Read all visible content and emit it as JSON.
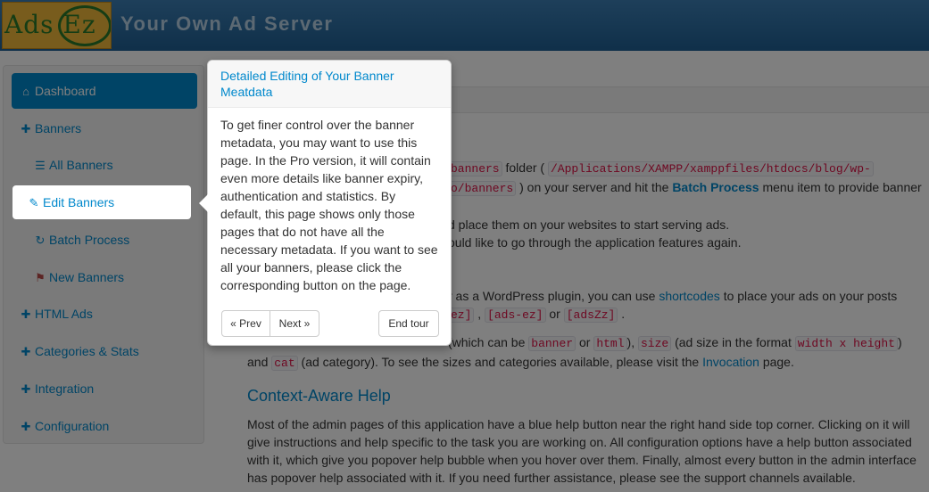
{
  "header": {
    "logo_text": "Ads Ez",
    "title": "Your Own Ad Server"
  },
  "sidebar": {
    "items": [
      {
        "label": "Dashboard",
        "icon": "home-icon"
      },
      {
        "label": "Banners",
        "icon": "plus-icon"
      },
      {
        "label": "All Banners",
        "icon": "list-icon"
      },
      {
        "label": "Edit Banners",
        "icon": "pencil-icon"
      },
      {
        "label": "Batch Process",
        "icon": "refresh-icon"
      },
      {
        "label": "New Banners",
        "icon": "flag-icon"
      },
      {
        "label": "HTML Ads",
        "icon": "plus-icon"
      },
      {
        "label": "Categories & Stats",
        "icon": "plus-icon"
      },
      {
        "label": "Integration",
        "icon": "plus-icon"
      },
      {
        "label": "Configuration",
        "icon": "plus-icon"
      }
    ]
  },
  "content": {
    "p1_frag1": "banners",
    "p1_frag2": "folder (",
    "p1_path1": "/Applications/XAMPP/xamppfiles/htdocs/blog/wp-",
    "p1_path2": "o/banners",
    "p1_frag3": ") on your server and hit the",
    "p1_link": "Batch Process",
    "p1_frag4": "menu item to provide banner",
    "p2": "d place them on your websites to start serving ads.",
    "p3": "ould like to go through the application features again.",
    "p4_frag1": "r as a WordPress plugin, you can use",
    "p4_link": "shortcodes",
    "p4_frag2": "to place your ads on your posts",
    "p4_code1": "ez]",
    "p4_code2": "[ads-ez]",
    "p4_or": "or",
    "p4_code3": "[adsZz]",
    "p5_frag1": "(which can be",
    "p5_code1": "banner",
    "p5_or": "or",
    "p5_code2": "html",
    "p5_frag2": "),",
    "p5_code3": "size",
    "p5_frag3": "(ad size in the format",
    "p5_code4": "width x height",
    "p5_frag4": ")",
    "p6_and": "and",
    "p6_code": "cat",
    "p6_frag1": "(ad category). To see the sizes and categories available, please visit the",
    "p6_link": "Invocation",
    "p6_frag2": "page.",
    "help_heading": "Context-Aware Help",
    "help_text": "Most of the admin pages of this application have a blue help button near the right hand side top corner. Clicking on it will give instructions and help specific to the task you are working on. All configuration options have a help button associated with it, which give you popover help bubble when you hover over them. Finally, almost every button in the admin interface has popover help associated with it. If you need further assistance, please see the support channels available."
  },
  "tour": {
    "title": "Detailed Editing of Your Banner Meatdata",
    "body": "To get finer control over the banner metadata, you may want to use this page. In the Pro version, it will contain even more details like banner expiry, authentication and statistics. By default, this page shows only those pages that do not have all the necessary metadata. If you want to see all your banners, please click the corresponding button on the page.",
    "prev_label": "« Prev",
    "next_label": "Next »",
    "end_label": "End tour"
  },
  "colors": {
    "accent": "#0088cc",
    "header": "#2a6ea4",
    "code": "#d14"
  }
}
